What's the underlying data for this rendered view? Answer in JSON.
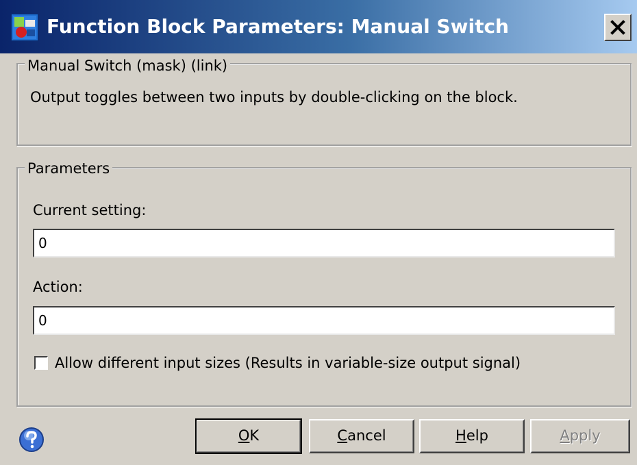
{
  "window": {
    "title": "Function Block Parameters: Manual Switch",
    "icon": "simulink-block-icon",
    "close_glyph": "×"
  },
  "description": {
    "legend": "Manual Switch (mask) (link)",
    "text": "Output toggles between two inputs by double-clicking on the block."
  },
  "parameters": {
    "legend": "Parameters",
    "current_setting": {
      "label": "Current setting:",
      "value": "0"
    },
    "action": {
      "label": "Action:",
      "value": "0"
    },
    "allow_different_sizes": {
      "label": "Allow different input sizes (Results in variable-size output signal)",
      "checked": false
    }
  },
  "buttons": {
    "ok": {
      "accel": "O",
      "rest": "K"
    },
    "cancel": {
      "accel": "C",
      "rest": "ancel"
    },
    "help": {
      "accel": "H",
      "rest": "elp"
    },
    "apply": {
      "accel": "A",
      "rest": "pply",
      "enabled": false
    }
  },
  "colors": {
    "titlebar_start": "#0a246a",
    "titlebar_end": "#a6caf0",
    "dialog_bg": "#d4d0c8",
    "disabled_text": "#808080"
  }
}
